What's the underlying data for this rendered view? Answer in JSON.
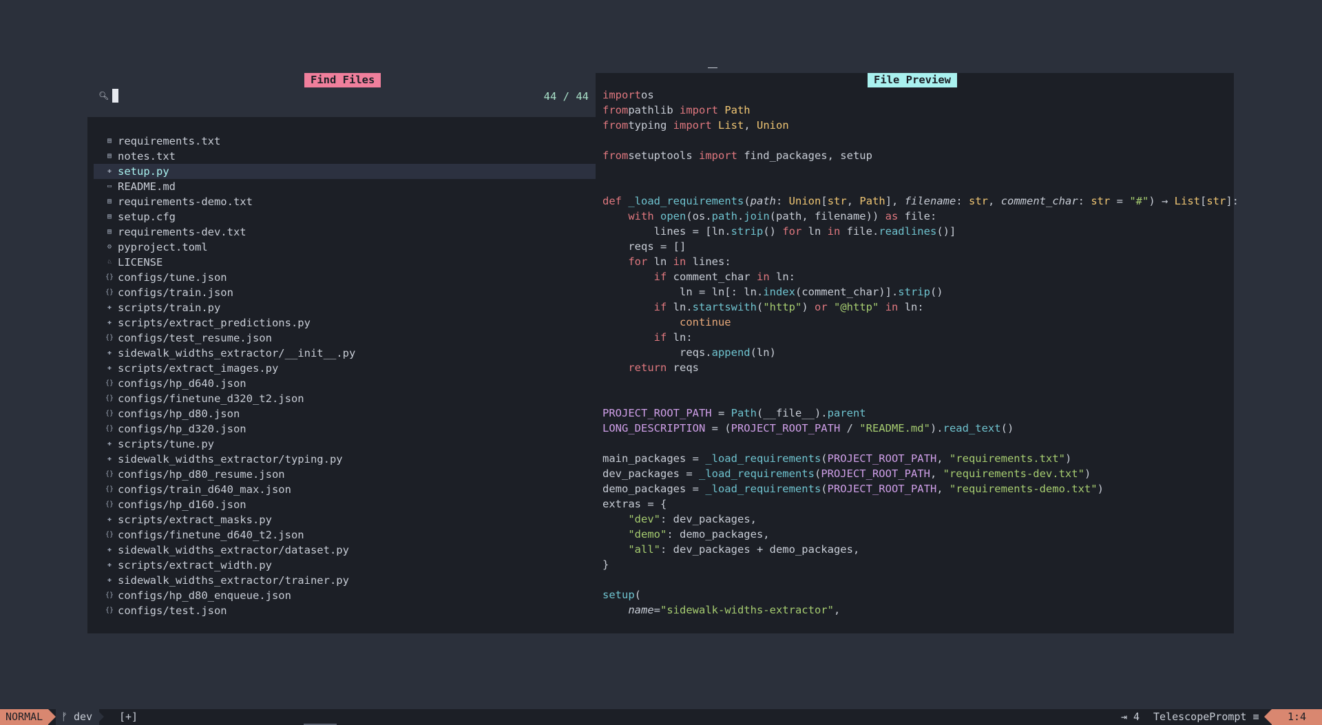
{
  "prompt": {
    "title": "Find Files",
    "query": "",
    "counter": "44 / 44",
    "icon": "search-icon"
  },
  "results": [
    {
      "name": "requirements.txt",
      "icon": "text-file-icon"
    },
    {
      "name": "notes.txt",
      "icon": "text-file-icon"
    },
    {
      "name": "setup.py",
      "icon": "python-icon"
    },
    {
      "name": "README.md",
      "icon": "markdown-icon"
    },
    {
      "name": "requirements-demo.txt",
      "icon": "text-file-icon"
    },
    {
      "name": "setup.cfg",
      "icon": "config-file-icon"
    },
    {
      "name": "requirements-dev.txt",
      "icon": "text-file-icon"
    },
    {
      "name": "pyproject.toml",
      "icon": "gear-icon"
    },
    {
      "name": "LICENSE",
      "icon": "license-icon"
    },
    {
      "name": "configs/tune.json",
      "icon": "json-icon"
    },
    {
      "name": "configs/train.json",
      "icon": "json-icon"
    },
    {
      "name": "scripts/train.py",
      "icon": "python-icon"
    },
    {
      "name": "scripts/extract_predictions.py",
      "icon": "python-icon"
    },
    {
      "name": "configs/test_resume.json",
      "icon": "json-icon"
    },
    {
      "name": "sidewalk_widths_extractor/__init__.py",
      "icon": "python-icon"
    },
    {
      "name": "scripts/extract_images.py",
      "icon": "python-icon"
    },
    {
      "name": "configs/hp_d640.json",
      "icon": "json-icon"
    },
    {
      "name": "configs/finetune_d320_t2.json",
      "icon": "json-icon"
    },
    {
      "name": "configs/hp_d80.json",
      "icon": "json-icon"
    },
    {
      "name": "configs/hp_d320.json",
      "icon": "json-icon"
    },
    {
      "name": "scripts/tune.py",
      "icon": "python-icon"
    },
    {
      "name": "sidewalk_widths_extractor/typing.py",
      "icon": "python-icon"
    },
    {
      "name": "configs/hp_d80_resume.json",
      "icon": "json-icon"
    },
    {
      "name": "configs/train_d640_max.json",
      "icon": "json-icon"
    },
    {
      "name": "configs/hp_d160.json",
      "icon": "json-icon"
    },
    {
      "name": "scripts/extract_masks.py",
      "icon": "python-icon"
    },
    {
      "name": "configs/finetune_d640_t2.json",
      "icon": "json-icon"
    },
    {
      "name": "sidewalk_widths_extractor/dataset.py",
      "icon": "python-icon"
    },
    {
      "name": "scripts/extract_width.py",
      "icon": "python-icon"
    },
    {
      "name": "sidewalk_widths_extractor/trainer.py",
      "icon": "python-icon"
    },
    {
      "name": "configs/hp_d80_enqueue.json",
      "icon": "json-icon"
    },
    {
      "name": "configs/test.json",
      "icon": "json-icon"
    }
  ],
  "selected_index": 2,
  "preview": {
    "title": "File Preview",
    "lines": [
      [
        [
          "k",
          "import"
        ],
        [
          "",
          "os"
        ]
      ],
      [
        [
          "k",
          "from"
        ],
        [
          "",
          "pathlib "
        ],
        [
          "k",
          "import"
        ],
        [
          "c",
          " Path"
        ]
      ],
      [
        [
          "k",
          "from"
        ],
        [
          "",
          "typing "
        ],
        [
          "k",
          "import"
        ],
        [
          "c",
          " List"
        ],
        [
          "",
          ", "
        ],
        [
          "c",
          "Union"
        ]
      ],
      [],
      [
        [
          "k",
          "from"
        ],
        [
          "",
          "setuptools "
        ],
        [
          "k",
          "import"
        ],
        [
          "",
          " find_packages, setup"
        ]
      ],
      [],
      [],
      [
        [
          "k",
          "def"
        ],
        [
          "",
          " "
        ],
        [
          "f",
          "_load_requirements"
        ],
        [
          "",
          "("
        ],
        [
          "i",
          "path"
        ],
        [
          "",
          ": "
        ],
        [
          "c",
          "Union"
        ],
        [
          "",
          "["
        ],
        [
          "c",
          "str"
        ],
        [
          "",
          ", "
        ],
        [
          "c",
          "Path"
        ],
        [
          "",
          "], "
        ],
        [
          "i",
          "filename"
        ],
        [
          "",
          ": "
        ],
        [
          "c",
          "str"
        ],
        [
          "",
          ", "
        ],
        [
          "i",
          "comment_char"
        ],
        [
          "",
          ": "
        ],
        [
          "c",
          "str"
        ],
        [
          "",
          " = "
        ],
        [
          "s",
          "\"#\""
        ],
        [
          "",
          ") → "
        ],
        [
          "c",
          "List"
        ],
        [
          "",
          "["
        ],
        [
          "c",
          "str"
        ],
        [
          "",
          "]:"
        ]
      ],
      [
        [
          "",
          "    "
        ],
        [
          "k",
          "with"
        ],
        [
          "",
          " "
        ],
        [
          "f",
          "open"
        ],
        [
          "",
          "(os."
        ],
        [
          "f",
          "path"
        ],
        [
          "",
          "."
        ],
        [
          "f",
          "join"
        ],
        [
          "",
          "(path, filename)) "
        ],
        [
          "k",
          "as"
        ],
        [
          "",
          " file:"
        ]
      ],
      [
        [
          "",
          "        lines = [ln."
        ],
        [
          "f",
          "strip"
        ],
        [
          "",
          "() "
        ],
        [
          "k",
          "for"
        ],
        [
          "",
          " ln "
        ],
        [
          "k",
          "in"
        ],
        [
          "",
          " file."
        ],
        [
          "f",
          "readlines"
        ],
        [
          "",
          "()]"
        ]
      ],
      [
        [
          "",
          "    reqs = []"
        ]
      ],
      [
        [
          "",
          "    "
        ],
        [
          "k",
          "for"
        ],
        [
          "",
          " ln "
        ],
        [
          "k",
          "in"
        ],
        [
          "",
          " lines:"
        ]
      ],
      [
        [
          "",
          "        "
        ],
        [
          "k",
          "if"
        ],
        [
          "",
          " comment_char "
        ],
        [
          "k",
          "in"
        ],
        [
          "",
          " ln:"
        ]
      ],
      [
        [
          "",
          "            ln = ln[: ln."
        ],
        [
          "f",
          "index"
        ],
        [
          "",
          "(comment_char)]."
        ],
        [
          "f",
          "strip"
        ],
        [
          "",
          "()"
        ]
      ],
      [
        [
          "",
          "        "
        ],
        [
          "k",
          "if"
        ],
        [
          "",
          " ln."
        ],
        [
          "f",
          "startswith"
        ],
        [
          "",
          "("
        ],
        [
          "s",
          "\"http\""
        ],
        [
          "",
          ") "
        ],
        [
          "k",
          "or"
        ],
        [
          "",
          " "
        ],
        [
          "s",
          "\"@http\""
        ],
        [
          "",
          " "
        ],
        [
          "k",
          "in"
        ],
        [
          "",
          " ln:"
        ]
      ],
      [
        [
          "",
          "            "
        ],
        [
          "o",
          "continue"
        ]
      ],
      [
        [
          "",
          "        "
        ],
        [
          "k",
          "if"
        ],
        [
          "",
          " ln:"
        ]
      ],
      [
        [
          "",
          "            reqs."
        ],
        [
          "f",
          "append"
        ],
        [
          "",
          "(ln)"
        ]
      ],
      [
        [
          "",
          "    "
        ],
        [
          "k",
          "return"
        ],
        [
          "",
          " reqs"
        ]
      ],
      [],
      [],
      [
        [
          "p",
          "PROJECT_ROOT_PATH"
        ],
        [
          "",
          " = "
        ],
        [
          "f",
          "Path"
        ],
        [
          "",
          "(__file__)."
        ],
        [
          "f",
          "parent"
        ]
      ],
      [
        [
          "p",
          "LONG_DESCRIPTION"
        ],
        [
          "",
          " = ("
        ],
        [
          "p",
          "PROJECT_ROOT_PATH"
        ],
        [
          "",
          " / "
        ],
        [
          "s",
          "\"README.md\""
        ],
        [
          "",
          ")."
        ],
        [
          "f",
          "read_text"
        ],
        [
          "",
          "()"
        ]
      ],
      [],
      [
        [
          "",
          "main_packages = "
        ],
        [
          "f",
          "_load_requirements"
        ],
        [
          "",
          "("
        ],
        [
          "p",
          "PROJECT_ROOT_PATH"
        ],
        [
          "",
          ", "
        ],
        [
          "s",
          "\"requirements.txt\""
        ],
        [
          "",
          ")"
        ]
      ],
      [
        [
          "",
          "dev_packages = "
        ],
        [
          "f",
          "_load_requirements"
        ],
        [
          "",
          "("
        ],
        [
          "p",
          "PROJECT_ROOT_PATH"
        ],
        [
          "",
          ", "
        ],
        [
          "s",
          "\"requirements-dev.txt\""
        ],
        [
          "",
          ")"
        ]
      ],
      [
        [
          "",
          "demo_packages = "
        ],
        [
          "f",
          "_load_requirements"
        ],
        [
          "",
          "("
        ],
        [
          "p",
          "PROJECT_ROOT_PATH"
        ],
        [
          "",
          ", "
        ],
        [
          "s",
          "\"requirements-demo.txt\""
        ],
        [
          "",
          ")"
        ]
      ],
      [
        [
          "",
          "extras = {"
        ]
      ],
      [
        [
          "",
          "    "
        ],
        [
          "s",
          "\"dev\""
        ],
        [
          "",
          ": dev_packages,"
        ]
      ],
      [
        [
          "",
          "    "
        ],
        [
          "s",
          "\"demo\""
        ],
        [
          "",
          ": demo_packages,"
        ]
      ],
      [
        [
          "",
          "    "
        ],
        [
          "s",
          "\"all\""
        ],
        [
          "",
          ": dev_packages + demo_packages,"
        ]
      ],
      [
        [
          "",
          "}"
        ]
      ],
      [],
      [
        [
          "f",
          "setup"
        ],
        [
          "",
          "("
        ]
      ],
      [
        [
          "",
          "    "
        ],
        [
          "i",
          "name"
        ],
        [
          "",
          "="
        ],
        [
          "s",
          "\"sidewalk-widths-extractor\""
        ],
        [
          "",
          ","
        ]
      ]
    ]
  },
  "statusline": {
    "mode": "NORMAL",
    "branch_icon": "git-branch-icon",
    "branch": "dev",
    "modified": "[+]",
    "indent": "⇥ 4",
    "filetype": "TelescopePrompt",
    "filetype_icon": "lines-icon",
    "position": "1:4"
  },
  "colors": {
    "background": "#2b303b",
    "panel": "#1c1f26",
    "prompt_title": "#f07f9c",
    "preview_title": "#a9f1ef",
    "mode_accent": "#d98770"
  }
}
